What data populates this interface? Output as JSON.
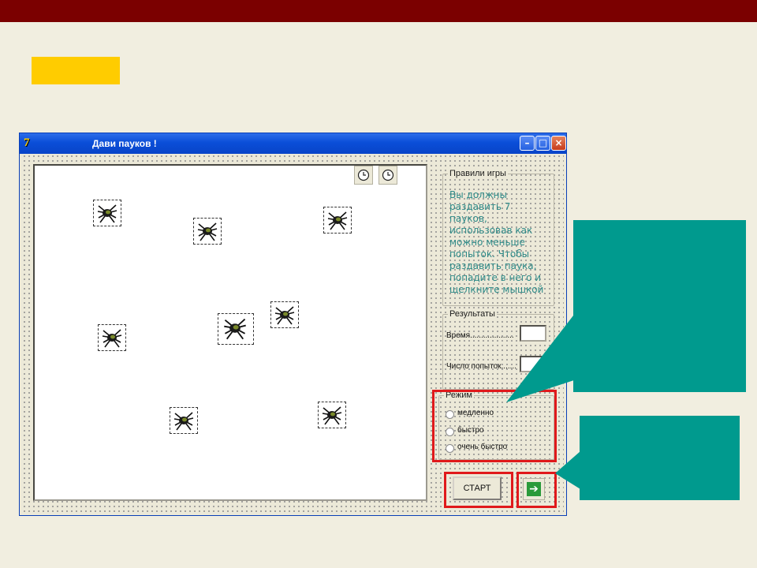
{
  "colors": {
    "top_bar": "#7b0000",
    "accent_tag": "#ffcc00",
    "callout": "#009a8e",
    "highlight": "#e0191b"
  },
  "window": {
    "title": "Дави пауков !",
    "app_icon": "7",
    "controls": [
      "minimize-icon",
      "maximize-icon",
      "close-icon"
    ]
  },
  "timers": [
    "clock-icon",
    "clock-icon"
  ],
  "spiders_count_shown": 8,
  "rules": {
    "legend": "Правили игры",
    "text": "  Вы должны\nраздавить 7\nпауков,\nиспользовав как\nможно меньше\nпопыток. Чтобы\nраздавить паука,\nпопадите в него и\nщелкните мышкой"
  },
  "results": {
    "legend": "Результаты",
    "time_label": "Время....................",
    "attempts_label": "Число попыток.......",
    "time_value": "",
    "attempts_value": ""
  },
  "mode": {
    "legend": "Режим",
    "options": [
      "медленно",
      "быстро",
      "очень быстро"
    ],
    "selected": null
  },
  "buttons": {
    "start_label": "СТАРТ",
    "go_icon": "arrow-right-icon"
  }
}
